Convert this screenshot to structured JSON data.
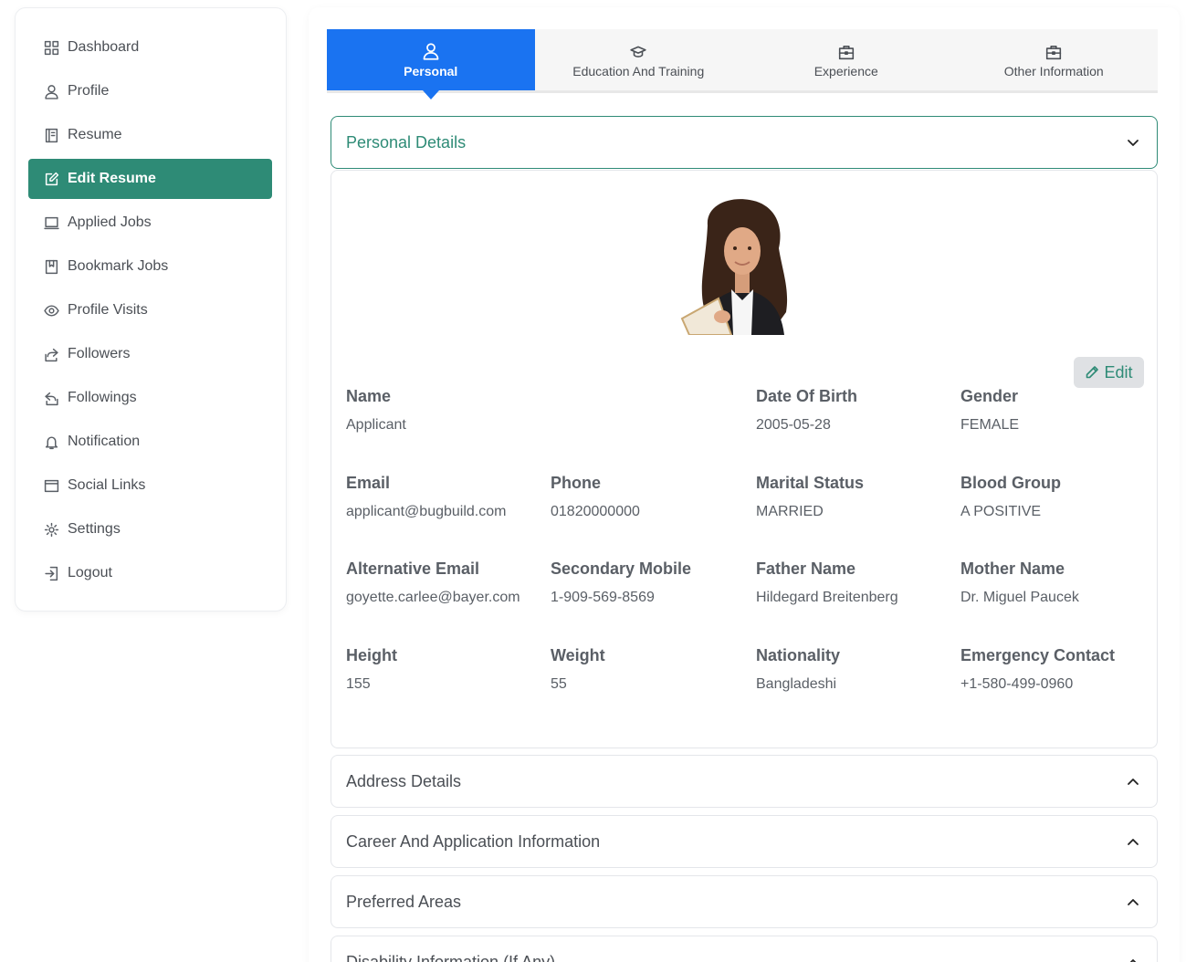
{
  "sidebar": {
    "items": [
      {
        "label": "Dashboard",
        "icon": "grid-icon",
        "active": false
      },
      {
        "label": "Profile",
        "icon": "user-icon",
        "active": false
      },
      {
        "label": "Resume",
        "icon": "file-icon",
        "active": false
      },
      {
        "label": "Edit Resume",
        "icon": "edit-icon",
        "active": true
      },
      {
        "label": "Applied Jobs",
        "icon": "laptop-icon",
        "active": false
      },
      {
        "label": "Bookmark Jobs",
        "icon": "bookmark-icon",
        "active": false
      },
      {
        "label": "Profile Visits",
        "icon": "eye-icon",
        "active": false
      },
      {
        "label": "Followers",
        "icon": "share-icon",
        "active": false
      },
      {
        "label": "Followings",
        "icon": "reply-icon",
        "active": false
      },
      {
        "label": "Notification",
        "icon": "bell-icon",
        "active": false
      },
      {
        "label": "Social Links",
        "icon": "browser-icon",
        "active": false
      },
      {
        "label": "Settings",
        "icon": "gear-icon",
        "active": false
      },
      {
        "label": "Logout",
        "icon": "logout-icon",
        "active": false
      }
    ]
  },
  "tabs": [
    {
      "label": "Personal",
      "icon": "user-icon",
      "active": true
    },
    {
      "label": "Education And Training",
      "icon": "graduation-cap-icon",
      "active": false
    },
    {
      "label": "Experience",
      "icon": "briefcase-icon",
      "active": false
    },
    {
      "label": "Other Information",
      "icon": "briefcase-icon",
      "active": false
    }
  ],
  "sections": {
    "personal": {
      "title": "Personal Details",
      "expanded": true
    },
    "address": {
      "title": "Address Details"
    },
    "career": {
      "title": "Career And Application Information"
    },
    "preferred": {
      "title": "Preferred Areas"
    },
    "disability": {
      "title": "Disability Information (If Any)"
    }
  },
  "edit_label": "Edit",
  "fields": {
    "name": {
      "label": "Name",
      "value": "Applicant"
    },
    "dob": {
      "label": "Date Of Birth",
      "value": "2005-05-28"
    },
    "gender": {
      "label": "Gender",
      "value": "FEMALE"
    },
    "email": {
      "label": "Email",
      "value": "applicant@bugbuild.com"
    },
    "phone": {
      "label": "Phone",
      "value": "01820000000"
    },
    "marital": {
      "label": "Marital Status",
      "value": "MARRIED"
    },
    "blood": {
      "label": "Blood Group",
      "value": "A POSITIVE"
    },
    "alt_email": {
      "label": "Alternative Email",
      "value": "goyette.carlee@bayer.com"
    },
    "secondary_mobile": {
      "label": "Secondary Mobile",
      "value": "1-909-569-8569"
    },
    "father": {
      "label": "Father Name",
      "value": "Hildegard Breitenberg"
    },
    "mother": {
      "label": "Mother Name",
      "value": "Dr. Miguel Paucek"
    },
    "height": {
      "label": "Height",
      "value": "155"
    },
    "weight": {
      "label": "Weight",
      "value": "55"
    },
    "nationality": {
      "label": "Nationality",
      "value": "Bangladeshi"
    },
    "emergency": {
      "label": "Emergency Contact",
      "value": "+1-580-499-0960"
    }
  },
  "colors": {
    "accent": "#2e8b76",
    "tab_active": "#1a73f1",
    "edit_bg": "#dfe1e4"
  }
}
